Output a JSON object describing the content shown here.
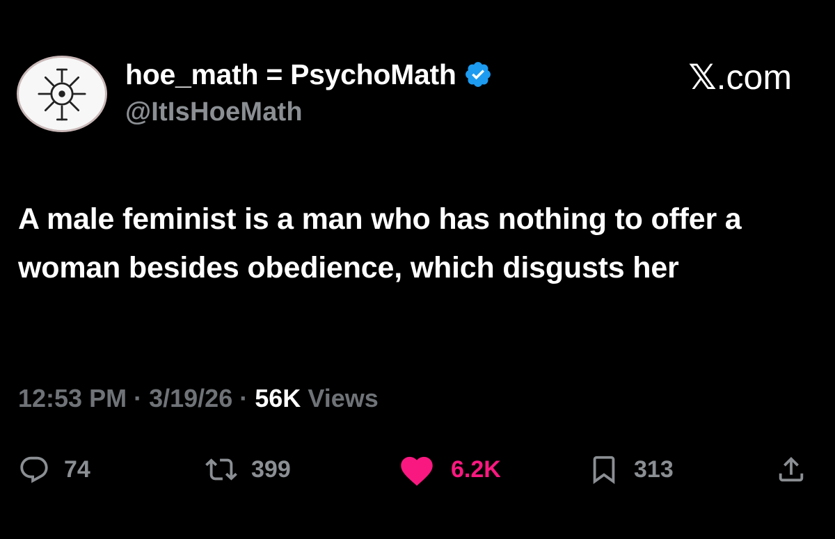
{
  "author": {
    "display_name": "hoe_math = PsychoMath",
    "handle": "@ItIsHoeMath",
    "verified": true,
    "avatar_icon": "sun-sigil-avatar",
    "verified_icon": "verified-badge-icon"
  },
  "brand": {
    "mark": "𝕏",
    "suffix": ".com"
  },
  "tweet": {
    "text": "A male feminist is a man who has nothing to offer a woman besides obedience, which disgusts her"
  },
  "meta": {
    "time": "12:53 PM",
    "separator": "·",
    "date": "3/19/26",
    "views_count": "56K",
    "views_label": "Views"
  },
  "actions": {
    "replies": {
      "icon": "reply-icon",
      "count": "74"
    },
    "reposts": {
      "icon": "repost-icon",
      "count": "399"
    },
    "likes": {
      "icon": "heart-icon",
      "count": "6.2K"
    },
    "bookmarks": {
      "icon": "bookmark-icon",
      "count": "313"
    },
    "share": {
      "icon": "share-icon"
    }
  },
  "colors": {
    "background": "#000000",
    "text": "#ffffff",
    "muted": "#8b8f93",
    "like": "#f91880",
    "verified": "#1d9bf0"
  }
}
